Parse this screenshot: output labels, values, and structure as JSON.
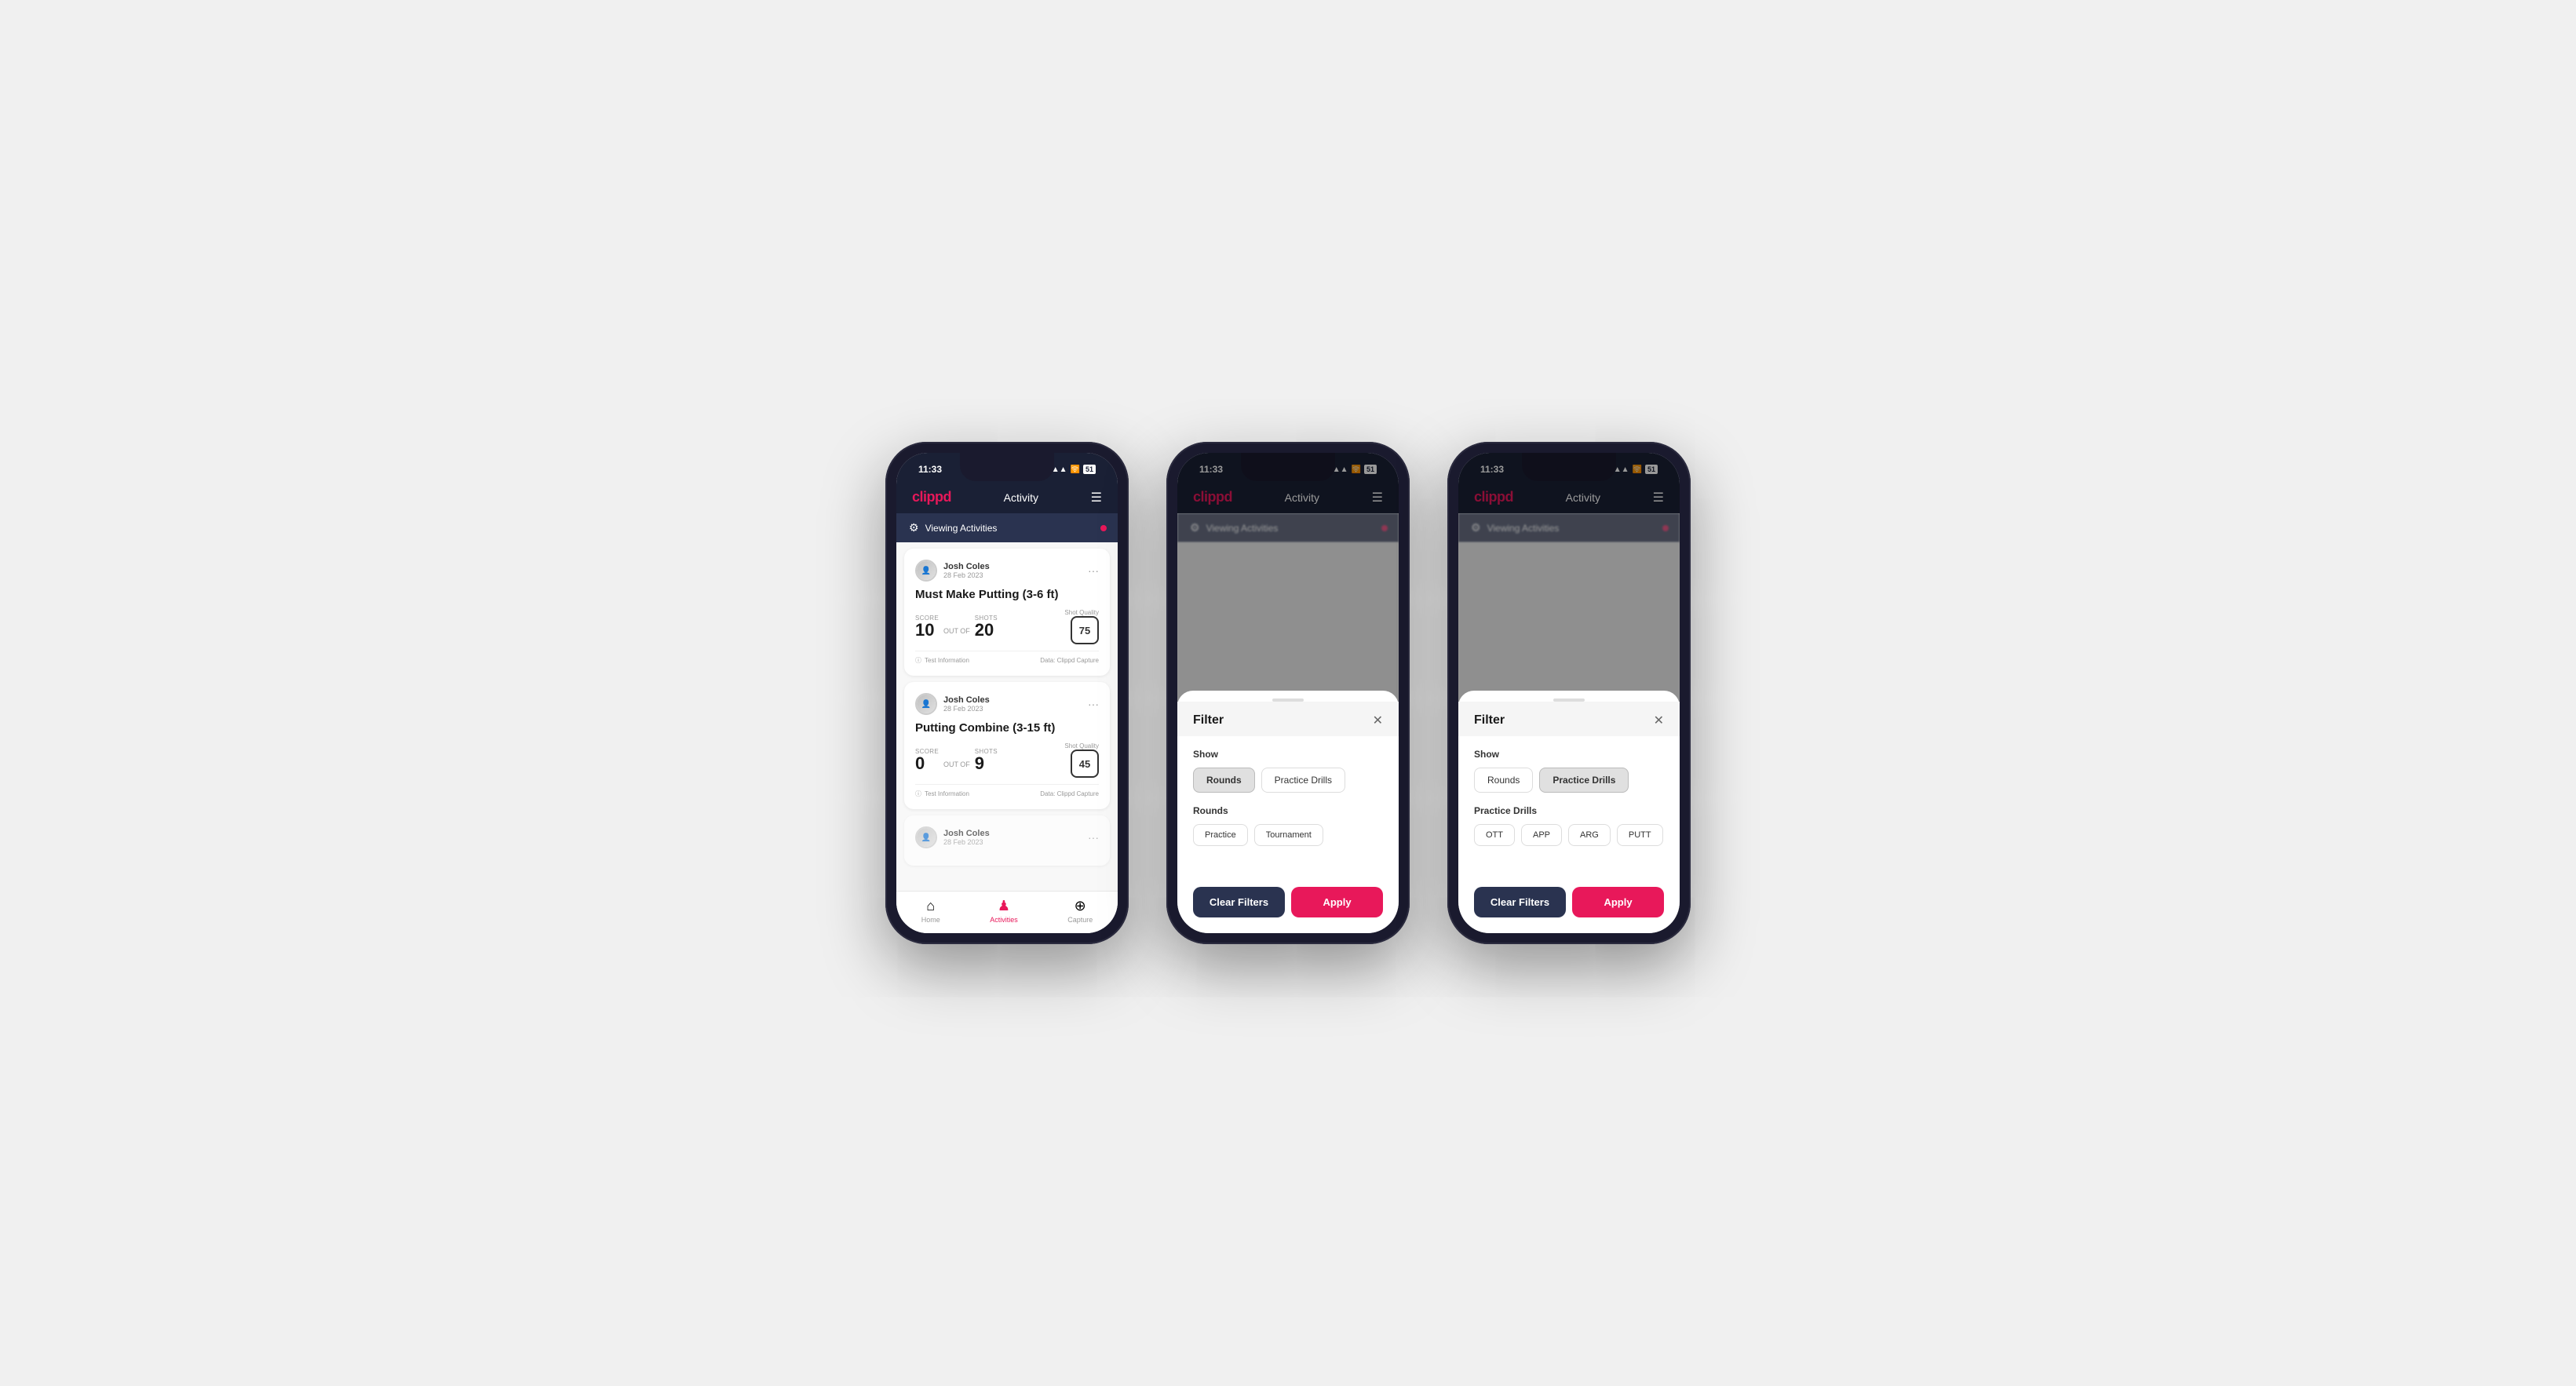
{
  "app": {
    "logo": "clippd",
    "header_title": "Activity",
    "time": "11:33",
    "status_icons": "▲ ᵀ ☐"
  },
  "phone1": {
    "viewing_bar": "Viewing Activities",
    "activities": [
      {
        "user_name": "Josh Coles",
        "user_date": "28 Feb 2023",
        "title": "Must Make Putting (3-6 ft)",
        "score_label": "Score",
        "score_value": "10",
        "out_of_label": "OUT OF",
        "shots_label": "Shots",
        "shots_value": "20",
        "shot_quality_label": "Shot Quality",
        "shot_quality_value": "75",
        "footer_left": "Test Information",
        "footer_right": "Data: Clippd Capture"
      },
      {
        "user_name": "Josh Coles",
        "user_date": "28 Feb 2023",
        "title": "Putting Combine (3-15 ft)",
        "score_label": "Score",
        "score_value": "0",
        "out_of_label": "OUT OF",
        "shots_label": "Shots",
        "shots_value": "9",
        "shot_quality_label": "Shot Quality",
        "shot_quality_value": "45",
        "footer_left": "Test Information",
        "footer_right": "Data: Clippd Capture"
      },
      {
        "user_name": "Josh Coles",
        "user_date": "28 Feb 2023",
        "title": "",
        "score_label": "",
        "score_value": "",
        "out_of_label": "",
        "shots_label": "",
        "shots_value": "",
        "shot_quality_label": "",
        "shot_quality_value": "",
        "footer_left": "",
        "footer_right": ""
      }
    ],
    "nav": {
      "home_label": "Home",
      "activities_label": "Activities",
      "capture_label": "Capture"
    }
  },
  "phone2": {
    "viewing_bar": "Viewing Activities",
    "filter": {
      "title": "Filter",
      "show_label": "Show",
      "rounds_btn": "Rounds",
      "practice_drills_btn": "Practice Drills",
      "rounds_section_label": "Rounds",
      "practice_btn": "Practice",
      "tournament_btn": "Tournament",
      "clear_filters_btn": "Clear Filters",
      "apply_btn": "Apply",
      "active_tab": "rounds"
    }
  },
  "phone3": {
    "viewing_bar": "Viewing Activities",
    "filter": {
      "title": "Filter",
      "show_label": "Show",
      "rounds_btn": "Rounds",
      "practice_drills_btn": "Practice Drills",
      "practice_drills_section_label": "Practice Drills",
      "ott_btn": "OTT",
      "app_btn": "APP",
      "arg_btn": "ARG",
      "putt_btn": "PUTT",
      "clear_filters_btn": "Clear Filters",
      "apply_btn": "Apply",
      "active_tab": "practice_drills"
    }
  }
}
